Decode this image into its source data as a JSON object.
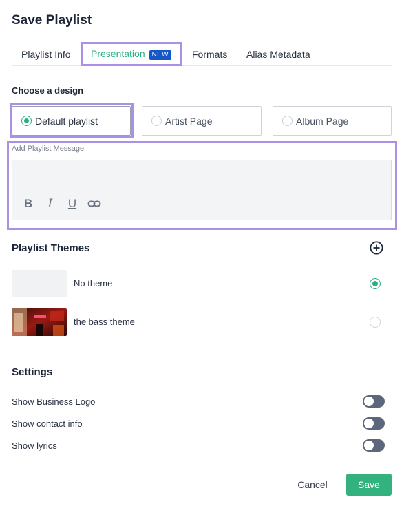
{
  "dialog": {
    "title": "Save Playlist"
  },
  "tabs": [
    {
      "label": "Playlist Info"
    },
    {
      "label": "Presentation",
      "badge": "NEW",
      "active": true
    },
    {
      "label": "Formats"
    },
    {
      "label": "Alias Metadata"
    }
  ],
  "design": {
    "label": "Choose a design",
    "options": [
      {
        "label": "Default playlist",
        "selected": true
      },
      {
        "label": "Artist Page",
        "selected": false
      },
      {
        "label": "Album Page",
        "selected": false
      }
    ]
  },
  "message": {
    "label": "Add Playlist Message",
    "value": "",
    "toolbar": [
      "bold-icon",
      "italic-icon",
      "underline-icon",
      "link-icon"
    ]
  },
  "themes": {
    "title": "Playlist Themes",
    "add_icon": "plus-circle-icon",
    "items": [
      {
        "name": "No theme",
        "selected": true
      },
      {
        "name": "the bass theme",
        "selected": false
      }
    ]
  },
  "settings": {
    "title": "Settings",
    "items": [
      {
        "label": "Show Business Logo",
        "enabled": false
      },
      {
        "label": "Show contact info",
        "enabled": false
      },
      {
        "label": "Show lyrics",
        "enabled": false
      }
    ]
  },
  "actions": {
    "cancel": "Cancel",
    "save": "Save"
  },
  "colors": {
    "accent": "#2bb07f",
    "highlight": "#a891e6",
    "badge": "#1357c8",
    "toggle_off": "#5d677c"
  }
}
